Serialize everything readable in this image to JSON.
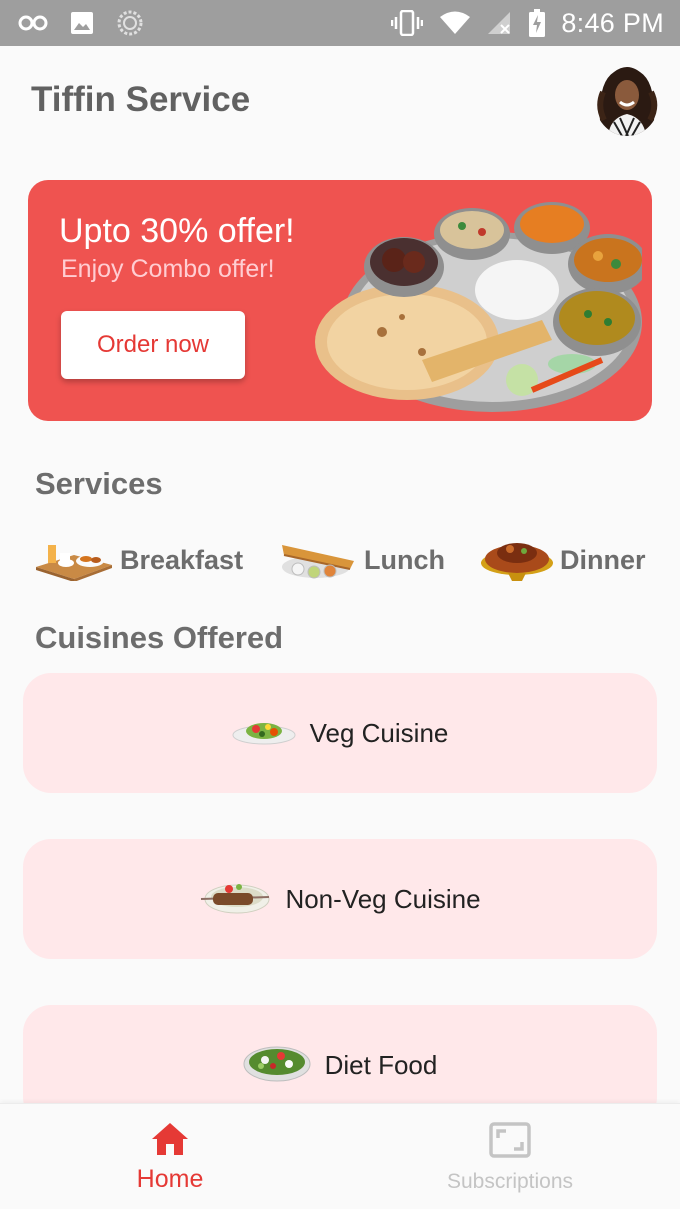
{
  "status_bar": {
    "time": "8:46 PM",
    "left_icons": [
      "glasses-icon",
      "image-icon",
      "sync-icon"
    ],
    "right_icons": [
      "vibrate-icon",
      "wifi-icon",
      "signal-off-icon",
      "battery-charging-icon"
    ]
  },
  "app_bar": {
    "title": "Tiffin Service",
    "avatar_icon": "user-avatar"
  },
  "banner": {
    "title": "Upto 30% offer!",
    "subtitle": "Enjoy Combo offer!",
    "button_label": "Order now",
    "image_icon": "thali-plate-image",
    "bg_color": "#ef5350"
  },
  "services": {
    "heading": "Services",
    "items": [
      {
        "label": "Breakfast",
        "icon": "breakfast-tray-icon"
      },
      {
        "label": "Lunch",
        "icon": "dosa-plate-icon"
      },
      {
        "label": "Dinner",
        "icon": "dinner-platter-icon"
      }
    ]
  },
  "cuisines": {
    "heading": "Cuisines Offered",
    "items": [
      {
        "label": "Veg Cuisine",
        "icon": "veg-plate-icon"
      },
      {
        "label": "Non-Veg Cuisine",
        "icon": "kebab-plate-icon"
      },
      {
        "label": "Diet Food",
        "icon": "salad-bowl-icon"
      }
    ],
    "card_color": "#ffe8ea"
  },
  "bottom_nav": {
    "items": [
      {
        "label": "Home",
        "icon": "home-icon",
        "active": true
      },
      {
        "label": "Subscriptions",
        "icon": "subscriptions-icon",
        "active": false
      }
    ],
    "active_color": "#e53935"
  }
}
